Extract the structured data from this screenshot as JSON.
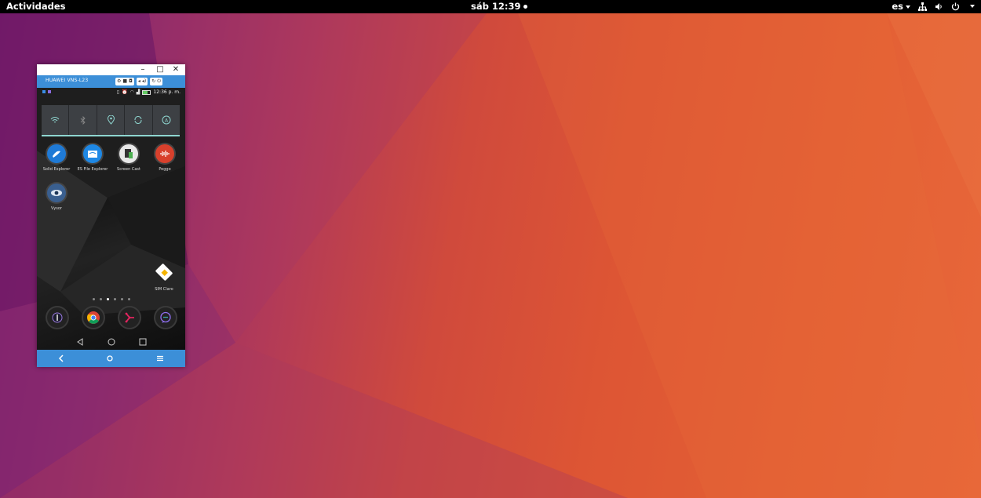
{
  "topbar": {
    "activities": "Actividades",
    "clock": "sáb 12:39",
    "language": "es"
  },
  "window": {
    "titlebar": {
      "minimize": "–",
      "maximize": "□",
      "close": "✕"
    },
    "device_name": "HUAWEI VNS-L23",
    "tool_icons": [
      "gear-icon",
      "video-icon",
      "camera-icon",
      "volume-down-icon",
      "volume-up-icon",
      "rotate-icon",
      "power-icon"
    ]
  },
  "phone": {
    "status_time": "12:36 p. m.",
    "quick_settings": [
      "wifi-icon",
      "bluetooth-icon",
      "location-icon",
      "rotation-icon",
      "auto-brightness-icon"
    ],
    "apps": [
      {
        "label": "Solid Explorer",
        "icon": "solid-explorer-icon"
      },
      {
        "label": "ES File Explorer",
        "icon": "es-file-explorer-icon"
      },
      {
        "label": "Screen Cast",
        "icon": "screen-cast-icon"
      },
      {
        "label": "Peggo",
        "icon": "peggo-icon"
      },
      {
        "label": "Vysor",
        "icon": "vysor-icon"
      }
    ],
    "sim_label": "SIM Claro",
    "page_dots": 6,
    "active_page": 3,
    "dock": [
      "phone-icon",
      "chrome-icon",
      "scissors-app-icon",
      "messages-icon"
    ],
    "navbar": [
      "back-icon",
      "home-icon",
      "recents-icon"
    ]
  },
  "footer": [
    "back-icon",
    "home-icon",
    "menu-icon"
  ],
  "colors": {
    "accent_blue": "#3c8fd8",
    "topbar": "#000000",
    "quick_settings_accent": "#8fd6d0"
  }
}
